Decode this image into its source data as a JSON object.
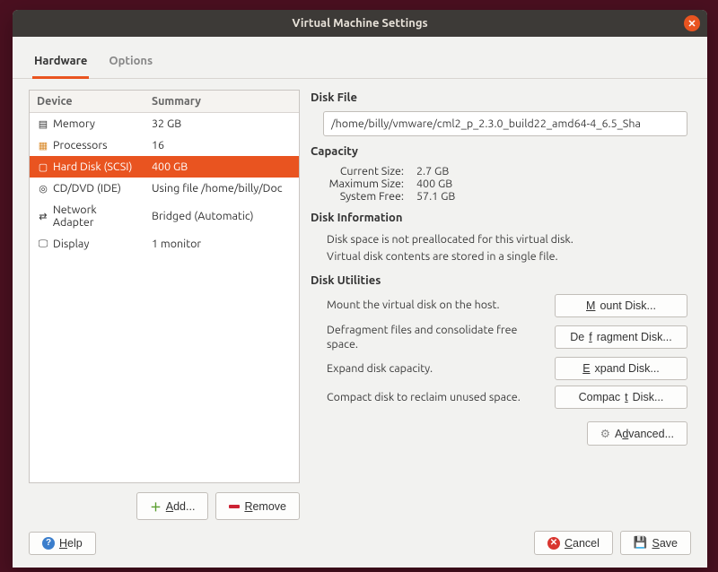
{
  "window": {
    "title": "Virtual Machine Settings"
  },
  "tabs": {
    "hardware": "Hardware",
    "options": "Options"
  },
  "device_table": {
    "header_device": "Device",
    "header_summary": "Summary",
    "rows": [
      {
        "icon": "memory-icon",
        "name": "Memory",
        "summary": "32 GB"
      },
      {
        "icon": "cpu-icon",
        "name": "Processors",
        "summary": "16"
      },
      {
        "icon": "disk-icon",
        "name": "Hard Disk (SCSI)",
        "summary": "400 GB"
      },
      {
        "icon": "cd-icon",
        "name": "CD/DVD (IDE)",
        "summary": "Using file /home/billy/Doc"
      },
      {
        "icon": "network-icon",
        "name": "Network Adapter",
        "summary": "Bridged (Automatic)"
      },
      {
        "icon": "display-icon",
        "name": "Display",
        "summary": "1 monitor"
      }
    ]
  },
  "buttons": {
    "add": "Add...",
    "remove": "Remove"
  },
  "right": {
    "disk_file_title": "Disk File",
    "disk_file_value": "/home/billy/vmware/cml2_p_2.3.0_build22_amd64-4_6.5_Sha",
    "capacity_title": "Capacity",
    "capacity": {
      "current_label": "Current Size:",
      "current_value": "2.7 GB",
      "max_label": "Maximum Size:",
      "max_value": "400 GB",
      "free_label": "System Free:",
      "free_value": "57.1 GB"
    },
    "info_title": "Disk Information",
    "info_line1": "Disk space is not preallocated for this virtual disk.",
    "info_line2": "Virtual disk contents are stored in a single file.",
    "util_title": "Disk Utilities",
    "utils": [
      {
        "desc": "Mount the virtual disk on the host.",
        "label": "Mount Disk..."
      },
      {
        "desc": "Defragment files and consolidate free space.",
        "label": "Defragment Disk..."
      },
      {
        "desc": "Expand disk capacity.",
        "label": "Expand Disk..."
      },
      {
        "desc": "Compact disk to reclaim unused space.",
        "label": "Compact Disk..."
      }
    ],
    "advanced": "Advanced..."
  },
  "footer": {
    "help": "Help",
    "cancel": "Cancel",
    "save": "Save"
  }
}
